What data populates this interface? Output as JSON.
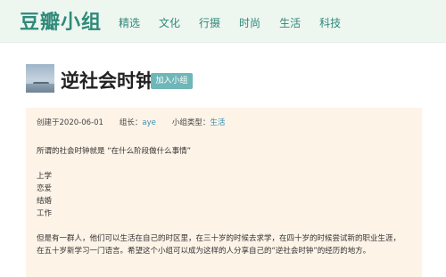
{
  "header": {
    "logo": "豆瓣小组",
    "nav": [
      "精选",
      "文化",
      "行摄",
      "时尚",
      "生活",
      "科技"
    ]
  },
  "group": {
    "title": "逆社会时钟",
    "join_label": "加入小组"
  },
  "info": {
    "created": "创建于2020-06-01",
    "leader_label": "组长：",
    "leader_name": "aye",
    "type_label": "小组类型：",
    "type_value": "生活",
    "intro": "所谓的社会时钟就是 “在什么阶段做什么事情”",
    "list": [
      "上学",
      "恋爱",
      "结婚",
      "工作"
    ],
    "para1_line1": "但是有一群人，他们可以生活在自己的时区里，在三十岁的时候去求学，在四十岁的时候尝试新的职业生涯，",
    "para1_line2": "在五十岁新学习一门语言。希望这个小组可以成为这样的人分享自己的“逆社会时钟”的经历的地方。"
  },
  "colors": {
    "brand": "#2f8a7a",
    "topbar_bg": "#eef6f0",
    "join_button": "#6fb6b8",
    "info_bg": "#fdf3e7",
    "link": "#3b8fb3"
  }
}
